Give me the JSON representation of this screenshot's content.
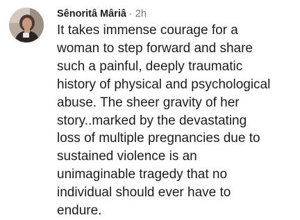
{
  "comment": {
    "author": "Sênoritâ Mâriâ",
    "separator": "·",
    "timestamp": "2h",
    "avatar_icon": "profile-photo-avatar",
    "lines": [
      "It takes immense courage for a",
      "woman to step forward and share",
      "such a painful, deeply traumatic",
      "history of physical and psychological",
      "abuse. The sheer gravity of her",
      "story..marked by the devastating",
      "loss of multiple pregnancies due to",
      "sustained violence is an",
      "unimaginable tragedy that no",
      "individual should ever have to",
      "endure."
    ]
  }
}
